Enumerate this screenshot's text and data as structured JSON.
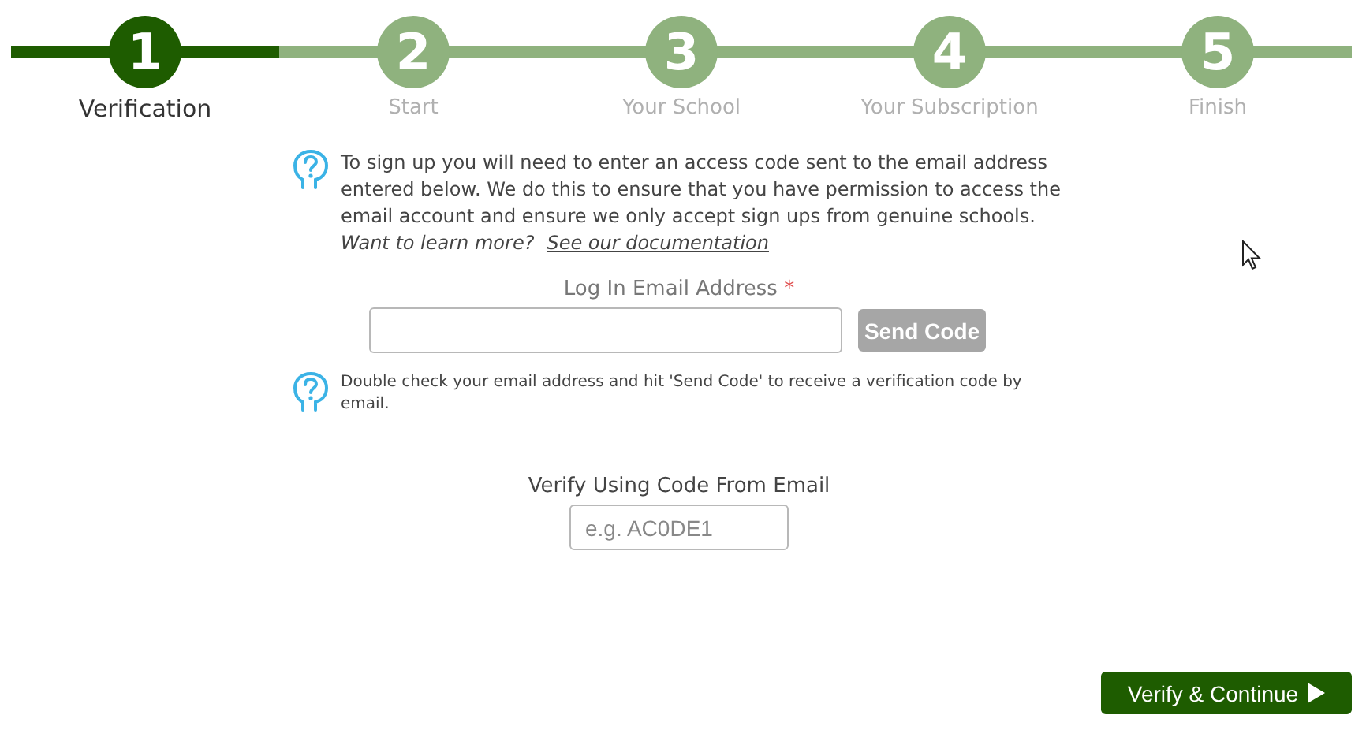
{
  "steps": [
    {
      "number": "1",
      "label": "Verification",
      "selected": true
    },
    {
      "number": "2",
      "label": "Start",
      "selected": false
    },
    {
      "number": "3",
      "label": "Your School",
      "selected": false
    },
    {
      "number": "4",
      "label": "Your Subscription",
      "selected": false
    },
    {
      "number": "5",
      "label": "Finish",
      "selected": false
    }
  ],
  "intro": {
    "text": "To sign up you will need to enter an access code sent to the email address entered below. We do this to ensure that you have permission to access the email account and ensure we only accept sign ups from genuine schools.",
    "learn_more": "Want to learn more?",
    "link": "See our documentation"
  },
  "email": {
    "label": "Log In Email Address",
    "required": "*",
    "button": "Send Code"
  },
  "hint": "Double check your email address and hit 'Send Code' to receive a verification code by email.",
  "code": {
    "label": "Verify Using Code From Email",
    "placeholder": "e.g. AC0DE1"
  },
  "continue_button": "Verify & Continue"
}
